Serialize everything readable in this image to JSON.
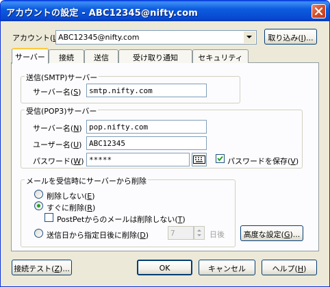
{
  "window": {
    "title": "アカウントの設定 - ABC12345@nifty.com"
  },
  "account": {
    "label": "アカウント(",
    "accel": "L",
    "value": "ABC12345@nifty.com",
    "import_button": "取り込み(",
    "import_accel": "I",
    "import_suffix": ")..."
  },
  "tabs": [
    {
      "label": "サーバー",
      "active": true
    },
    {
      "label": "接続"
    },
    {
      "label": "送信"
    },
    {
      "label": "受け取り通知"
    },
    {
      "label": "セキュリティ"
    }
  ],
  "smtp": {
    "group_title": "送信(SMTP)サーバー",
    "server_label": "サーバー名(",
    "server_accel": "S",
    "server_value": "smtp.nifty.com"
  },
  "pop3": {
    "group_title": "受信(POP3)サーバー",
    "server_label": "サーバー名(",
    "server_accel": "N",
    "server_value": "pop.nifty.com",
    "user_label": "ユーザー名(",
    "user_accel": "U",
    "user_value": "ABC12345",
    "password_label": "パスワード(",
    "password_accel": "W",
    "password_value": "*****",
    "save_password_label": "パスワードを保存(",
    "save_password_accel": "V",
    "save_password_checked": true
  },
  "delete_group": {
    "group_title": "メールを受信時にサーバーから削除",
    "opt_none": "削除しない(",
    "opt_none_accel": "E",
    "opt_now": "すぐに削除(",
    "opt_now_accel": "R",
    "postpet_label": "PostPetからのメールは削除しない(",
    "postpet_accel": "T",
    "opt_days": "送信日から指定日後に削除(",
    "opt_days_accel": "D",
    "days_value": "7",
    "days_unit": "日後",
    "selected": "now"
  },
  "advanced_button": {
    "label": "高度な設定(",
    "accel": "G",
    "suffix": ")..."
  },
  "footer": {
    "test_label": "接続テスト(",
    "test_accel": "Z",
    "test_suffix": ")...",
    "ok_label": "OK",
    "cancel_label": "キャンセル",
    "help_label": "ヘルプ(",
    "help_accel": "H"
  },
  "colors": {
    "titlebar": "#0A5FEA",
    "face": "#ECE9D8",
    "tab_highlight": "#FFC83C",
    "border": "#003C74"
  }
}
